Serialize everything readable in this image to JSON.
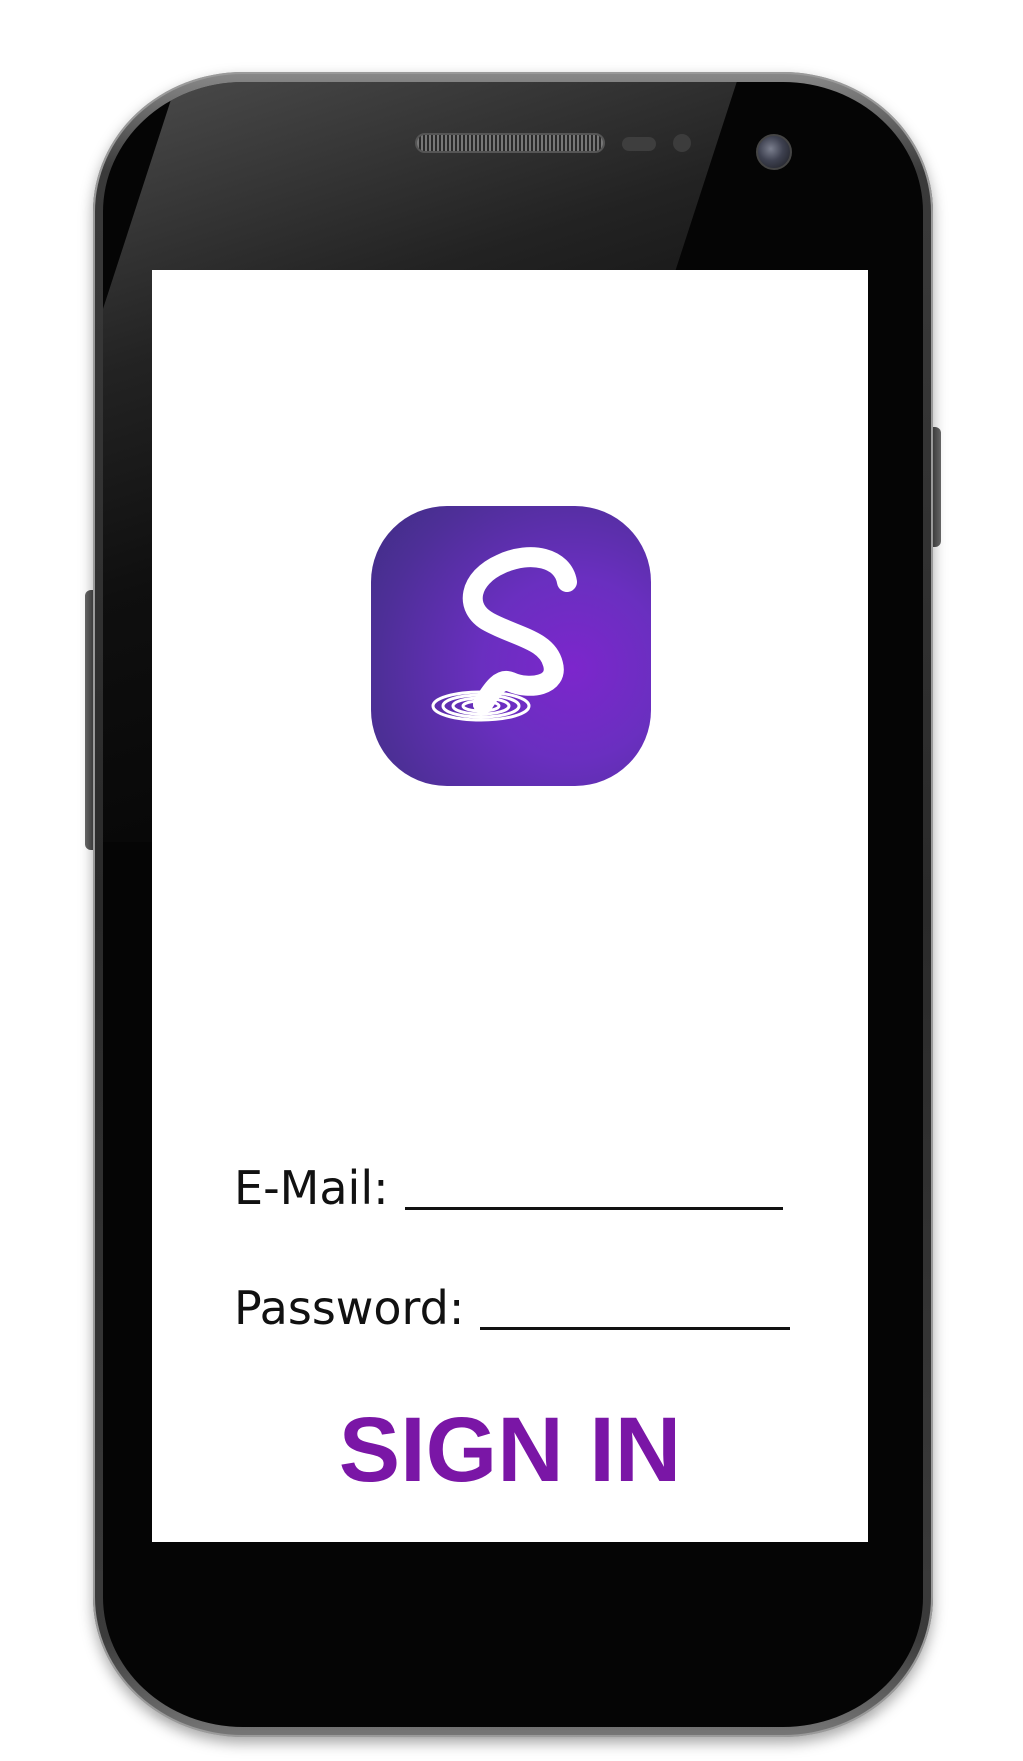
{
  "device": {
    "type": "smartphone-mockup",
    "frame_color": "#2a2a2a",
    "screen_color": "#ffffff"
  },
  "app": {
    "logo": {
      "icon": "swirl-s-logo-icon",
      "gradient_from": "#3f2e84",
      "gradient_to": "#7c26cc",
      "glyph_color": "#ffffff"
    }
  },
  "login_form": {
    "email_label": "E-Mail:",
    "email_value": "",
    "password_label": "Password:",
    "password_value": "",
    "signin_label": "SIGN IN",
    "signin_color": "#7a16a6"
  }
}
